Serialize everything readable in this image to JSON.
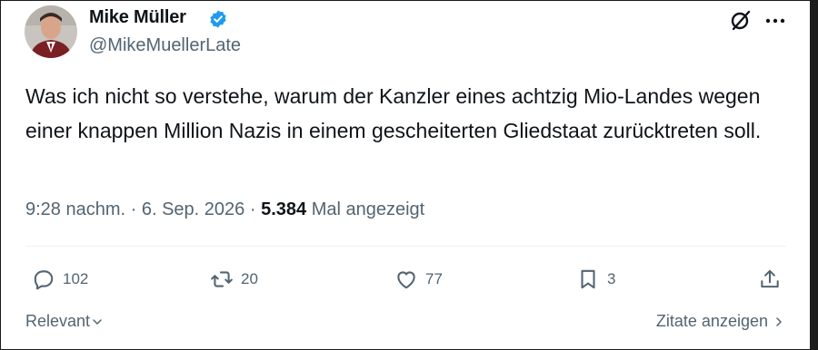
{
  "author": {
    "display_name": "Mike Müller",
    "handle": "@MikeMuellerLate",
    "verified": true
  },
  "tweet": {
    "text": "Was ich nicht so verstehe, warum der Kanzler eines achtzig Mio-Landes wegen einer knappen Million Nazis in einem gescheiterten Gliedstaat zurücktreten soll."
  },
  "meta": {
    "time": "9:28 nachm.",
    "separator": " · ",
    "date": "6. Sep. 2026",
    "views_count": "5.384",
    "views_label": " Mal angezeigt"
  },
  "actions": {
    "replies": "102",
    "reposts": "20",
    "likes": "77",
    "bookmarks": "3"
  },
  "footer": {
    "sort_label": "Relevant",
    "quotes_label": "Zitate anzeigen"
  },
  "icons": {
    "verified": "verified-badge-icon",
    "grok": "grok-icon",
    "more": "more-icon",
    "reply": "reply-icon",
    "repost": "repost-icon",
    "like": "heart-icon",
    "bookmark": "bookmark-icon",
    "share": "share-icon"
  },
  "colors": {
    "verified_blue": "#1d9bf0",
    "secondary_text": "#536471",
    "primary_text": "#0f1419"
  }
}
